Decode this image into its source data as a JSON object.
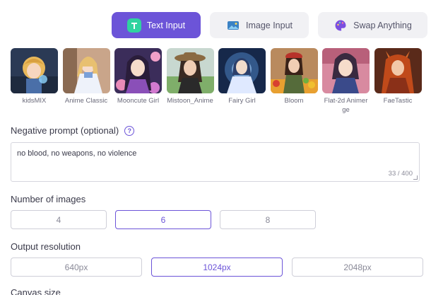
{
  "tabs": [
    {
      "label": "Text Input",
      "icon": "text-t-icon",
      "active": true
    },
    {
      "label": "Image Input",
      "icon": "image-icon",
      "active": false
    },
    {
      "label": "Swap Anything",
      "icon": "palette-icon",
      "active": false
    }
  ],
  "models": [
    {
      "name": "kidsMIX"
    },
    {
      "name": "Anime Classic"
    },
    {
      "name": "Mooncute Girl"
    },
    {
      "name": "Mistoon_Anime"
    },
    {
      "name": "Fairy Girl"
    },
    {
      "name": "Bloom"
    },
    {
      "name": "Flat-2d Animerge"
    },
    {
      "name": "FaeTastic"
    }
  ],
  "negative_prompt": {
    "label": "Negative prompt (optional)",
    "value": "no blood, no weapons, no violence",
    "counter": "33 / 400"
  },
  "num_images": {
    "label": "Number of images",
    "options": [
      "4",
      "6",
      "8"
    ],
    "selected": "6"
  },
  "resolution": {
    "label": "Output resolution",
    "options": [
      "640px",
      "1024px",
      "2048px"
    ],
    "selected": "1024px"
  },
  "canvas_size": {
    "label": "Canvas size"
  },
  "colors": {
    "accent": "#6c54d8",
    "tab_inactive_bg": "#f1f1f4"
  }
}
